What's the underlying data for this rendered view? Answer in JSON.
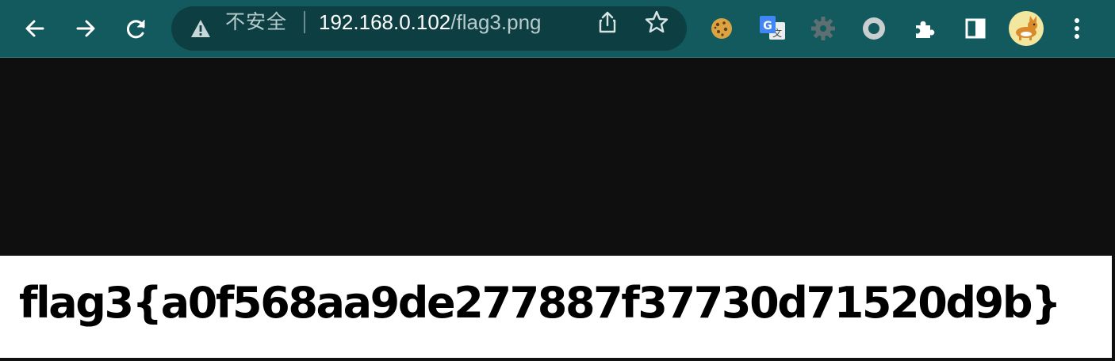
{
  "browser": {
    "nav": {
      "back": "arrow-left-icon",
      "forward": "arrow-right-icon",
      "reload": "reload-icon"
    },
    "omnibox": {
      "security_label": "不安全",
      "url_host": "192.168.0.102",
      "url_path": "/flag3.png"
    },
    "extensions": [
      "cookie-extension-icon",
      "google-translate-icon",
      "gear-extension-icon",
      "circle-extension-icon",
      "puzzle-icon",
      "side-panel-icon"
    ],
    "colors": {
      "toolbar": "#135a5e",
      "omnibox": "#0d3f42",
      "page_background": "#0f0f0f"
    }
  },
  "page": {
    "flag_text": "flag3{a0f568aa9de277887f37730d71520d9b}"
  }
}
